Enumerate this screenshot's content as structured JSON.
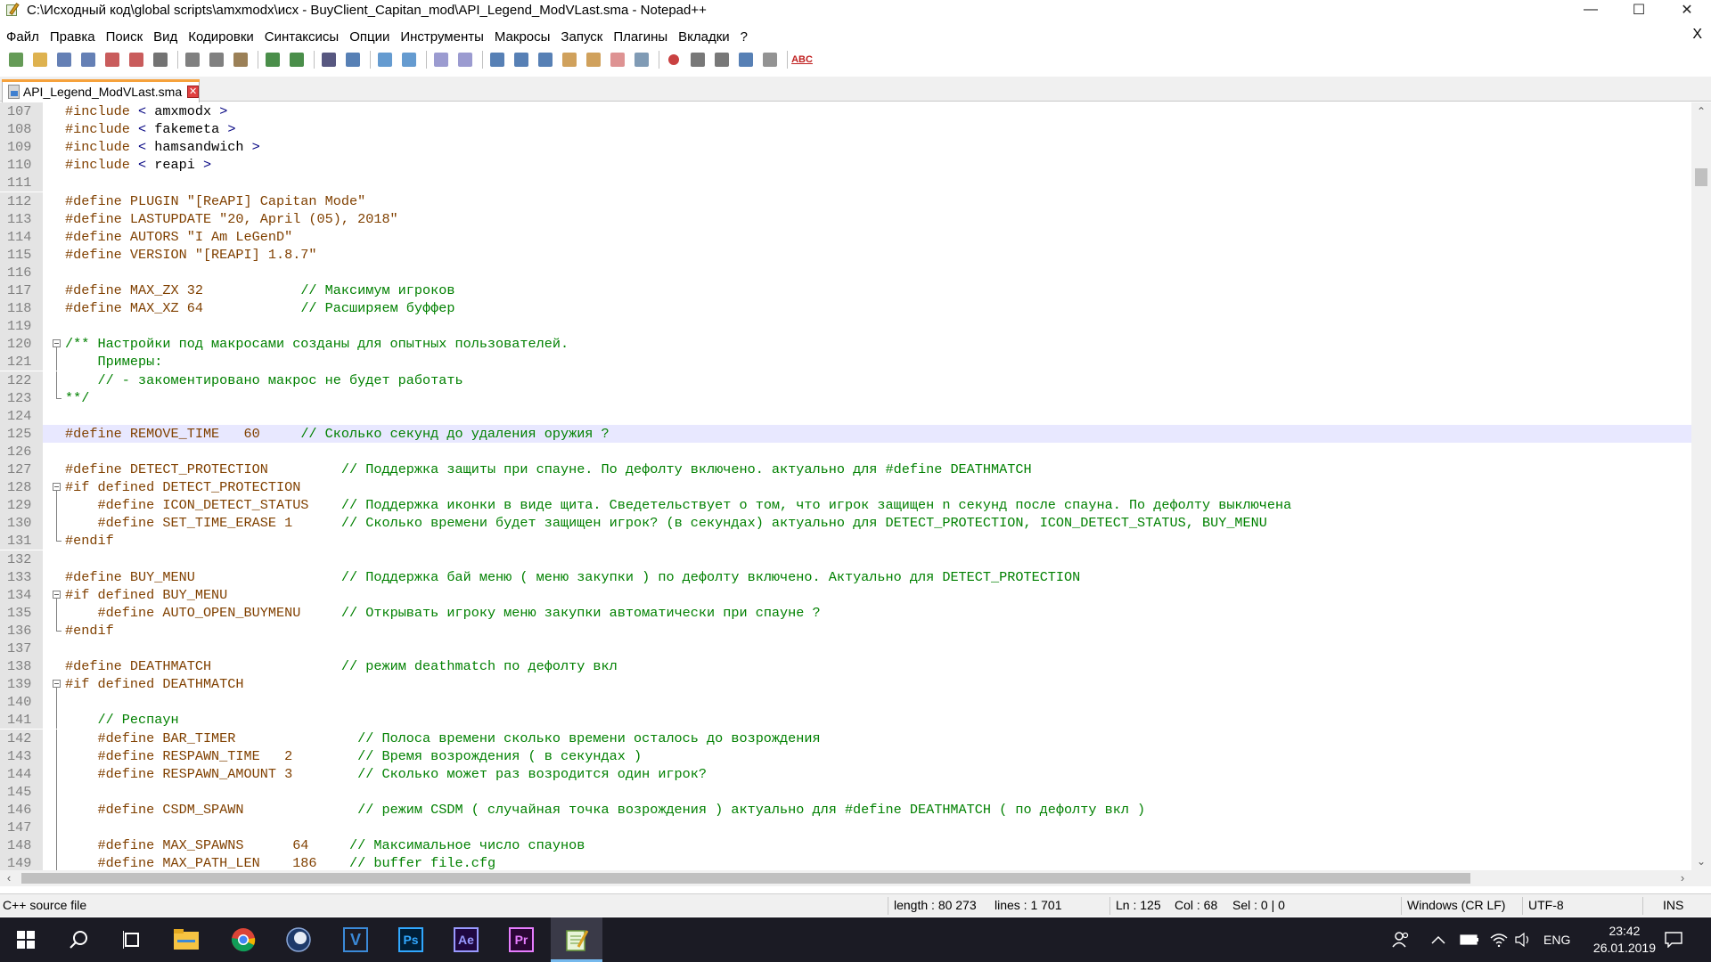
{
  "window": {
    "title": "C:\\Исходный код\\global scripts\\amxmodx\\исх - BuyClient_Capitan_mod\\API_Legend_ModVLast.sma - Notepad++",
    "minimize_glyph": "—",
    "maximize_glyph": "☐",
    "close_glyph": "✕"
  },
  "menu": {
    "items": [
      "Файл",
      "Правка",
      "Поиск",
      "Вид",
      "Кодировки",
      "Синтаксисы",
      "Опции",
      "Инструменты",
      "Макросы",
      "Запуск",
      "Плагины",
      "Вкладки",
      "?"
    ],
    "close_glyph": "X"
  },
  "toolbar": {
    "icons": [
      "new-file-icon",
      "open-file-icon",
      "save-icon",
      "save-all-icon",
      "close-file-icon",
      "close-all-icon",
      "print-icon",
      "cut-icon",
      "copy-icon",
      "paste-icon",
      "undo-icon",
      "redo-icon",
      "find-icon",
      "replace-icon",
      "zoom-in-icon",
      "zoom-out-icon",
      "sync-vertical-icon",
      "sync-horizontal-icon",
      "word-wrap-icon",
      "show-all-chars-icon",
      "indent-guide-icon",
      "doc-map-icon",
      "function-list-icon",
      "folder-workspace-icon",
      "monitoring-icon",
      "record-macro-icon",
      "stop-macro-icon",
      "play-macro-icon",
      "run-macro-multiple-icon",
      "save-macro-icon",
      "spellcheck-icon"
    ],
    "spellcheck_label": "ABC"
  },
  "tab": {
    "label": "API_Legend_ModVLast.sma",
    "close_glyph": "✕"
  },
  "editor": {
    "current_line": 125,
    "lines": [
      {
        "n": "107",
        "fold": "",
        "segs": [
          {
            "c": "pp",
            "t": "#include"
          },
          {
            "c": "tx",
            "t": " "
          },
          {
            "c": "op",
            "t": "<"
          },
          {
            "c": "tx",
            "t": " amxmodx "
          },
          {
            "c": "op",
            "t": ">"
          }
        ]
      },
      {
        "n": "108",
        "fold": "",
        "segs": [
          {
            "c": "pp",
            "t": "#include"
          },
          {
            "c": "tx",
            "t": " "
          },
          {
            "c": "op",
            "t": "<"
          },
          {
            "c": "tx",
            "t": " fakemeta "
          },
          {
            "c": "op",
            "t": ">"
          }
        ]
      },
      {
        "n": "109",
        "fold": "",
        "segs": [
          {
            "c": "pp",
            "t": "#include"
          },
          {
            "c": "tx",
            "t": " "
          },
          {
            "c": "op",
            "t": "<"
          },
          {
            "c": "tx",
            "t": " hamsandwich "
          },
          {
            "c": "op",
            "t": ">"
          }
        ]
      },
      {
        "n": "110",
        "fold": "",
        "segs": [
          {
            "c": "pp",
            "t": "#include"
          },
          {
            "c": "tx",
            "t": " "
          },
          {
            "c": "op",
            "t": "<"
          },
          {
            "c": "tx",
            "t": " reapi "
          },
          {
            "c": "op",
            "t": ">"
          }
        ]
      },
      {
        "n": "111",
        "fold": "",
        "segs": []
      },
      {
        "n": "112",
        "fold": "",
        "segs": [
          {
            "c": "pp",
            "t": "#define PLUGIN \"[ReAPI] Capitan Mode\""
          }
        ]
      },
      {
        "n": "113",
        "fold": "",
        "segs": [
          {
            "c": "pp",
            "t": "#define LASTUPDATE \"20, April (05), 2018\""
          }
        ]
      },
      {
        "n": "114",
        "fold": "",
        "segs": [
          {
            "c": "pp",
            "t": "#define AUTORS \"I Am LeGenD\""
          }
        ]
      },
      {
        "n": "115",
        "fold": "",
        "segs": [
          {
            "c": "pp",
            "t": "#define VERSION \"[REAPI] 1.8.7\""
          }
        ]
      },
      {
        "n": "116",
        "fold": "",
        "segs": []
      },
      {
        "n": "117",
        "fold": "",
        "segs": [
          {
            "c": "pp",
            "t": "#define MAX_ZX 32            "
          },
          {
            "c": "cm",
            "t": "// Максимум игроков"
          }
        ]
      },
      {
        "n": "118",
        "fold": "",
        "segs": [
          {
            "c": "pp",
            "t": "#define MAX_XZ 64            "
          },
          {
            "c": "cm",
            "t": "// Расширяем буффер"
          }
        ]
      },
      {
        "n": "119",
        "fold": "",
        "segs": []
      },
      {
        "n": "120",
        "fold": "open",
        "segs": [
          {
            "c": "cm",
            "t": "/** Настройки под макросами созданы для опытных пользователей."
          }
        ]
      },
      {
        "n": "121",
        "fold": "mid",
        "segs": [
          {
            "c": "cm",
            "t": "    Примеры:"
          }
        ]
      },
      {
        "n": "122",
        "fold": "mid",
        "segs": [
          {
            "c": "cm",
            "t": "    // - закоментировано макрос не будет работать"
          }
        ]
      },
      {
        "n": "123",
        "fold": "end",
        "segs": [
          {
            "c": "cm",
            "t": "**/"
          }
        ]
      },
      {
        "n": "124",
        "fold": "",
        "segs": []
      },
      {
        "n": "125",
        "fold": "",
        "segs": [
          {
            "c": "pp",
            "t": "#define REMOVE_TIME   60     "
          },
          {
            "c": "cm",
            "t": "// Сколько секунд до удаления оружия ?"
          }
        ]
      },
      {
        "n": "126",
        "fold": "",
        "segs": []
      },
      {
        "n": "127",
        "fold": "",
        "segs": [
          {
            "c": "pp",
            "t": "#define DETECT_PROTECTION         "
          },
          {
            "c": "cm",
            "t": "// Поддержка защиты при спауне. По дефолту включено. актуально для #define DEATHMATCH"
          }
        ]
      },
      {
        "n": "128",
        "fold": "open",
        "segs": [
          {
            "c": "pp",
            "t": "#if defined DETECT_PROTECTION"
          }
        ]
      },
      {
        "n": "129",
        "fold": "mid",
        "segs": [
          {
            "c": "pp",
            "t": "    #define ICON_DETECT_STATUS    "
          },
          {
            "c": "cm",
            "t": "// Поддержка иконки в виде щита. Сведетельствует о том, что игрок защищен n секунд после спауна. По дефолту выключена"
          }
        ]
      },
      {
        "n": "130",
        "fold": "mid",
        "segs": [
          {
            "c": "pp",
            "t": "    #define SET_TIME_ERASE 1      "
          },
          {
            "c": "cm",
            "t": "// Сколько времени будет защищен игрок? (в секундах) актуально для DETECT_PROTECTION, ICON_DETECT_STATUS, BUY_MENU"
          }
        ]
      },
      {
        "n": "131",
        "fold": "end",
        "segs": [
          {
            "c": "pp",
            "t": "#endif"
          }
        ]
      },
      {
        "n": "132",
        "fold": "",
        "segs": []
      },
      {
        "n": "133",
        "fold": "",
        "segs": [
          {
            "c": "pp",
            "t": "#define BUY_MENU                  "
          },
          {
            "c": "cm",
            "t": "// Поддержка бай меню ( меню закупки ) по дефолту включено. Актуально для DETECT_PROTECTION"
          }
        ]
      },
      {
        "n": "134",
        "fold": "open",
        "segs": [
          {
            "c": "pp",
            "t": "#if defined BUY_MENU"
          }
        ]
      },
      {
        "n": "135",
        "fold": "mid",
        "segs": [
          {
            "c": "pp",
            "t": "    #define AUTO_OPEN_BUYMENU     "
          },
          {
            "c": "cm",
            "t": "// Открывать игроку меню закупки автоматически при спауне ?"
          }
        ]
      },
      {
        "n": "136",
        "fold": "end",
        "segs": [
          {
            "c": "pp",
            "t": "#endif"
          }
        ]
      },
      {
        "n": "137",
        "fold": "",
        "segs": []
      },
      {
        "n": "138",
        "fold": "",
        "segs": [
          {
            "c": "pp",
            "t": "#define DEATHMATCH                "
          },
          {
            "c": "cm",
            "t": "// режим deathmatch по дефолту вкл"
          }
        ]
      },
      {
        "n": "139",
        "fold": "open",
        "segs": [
          {
            "c": "pp",
            "t": "#if defined DEATHMATCH"
          }
        ]
      },
      {
        "n": "140",
        "fold": "mid",
        "segs": []
      },
      {
        "n": "141",
        "fold": "mid",
        "segs": [
          {
            "c": "cm",
            "t": "    // Респаун"
          }
        ]
      },
      {
        "n": "142",
        "fold": "mid",
        "segs": [
          {
            "c": "pp",
            "t": "    #define BAR_TIMER               "
          },
          {
            "c": "cm",
            "t": "// Полоса времени сколько времени осталось до возрождения"
          }
        ]
      },
      {
        "n": "143",
        "fold": "mid",
        "segs": [
          {
            "c": "pp",
            "t": "    #define RESPAWN_TIME   2        "
          },
          {
            "c": "cm",
            "t": "// Время возрождения ( в секундах )"
          }
        ]
      },
      {
        "n": "144",
        "fold": "mid",
        "segs": [
          {
            "c": "pp",
            "t": "    #define RESPAWN_AMOUNT 3        "
          },
          {
            "c": "cm",
            "t": "// Сколько может раз возродится один игрок?"
          }
        ]
      },
      {
        "n": "145",
        "fold": "mid",
        "segs": []
      },
      {
        "n": "146",
        "fold": "mid",
        "segs": [
          {
            "c": "pp",
            "t": "    #define CSDM_SPAWN              "
          },
          {
            "c": "cm",
            "t": "// режим CSDM ( случайная точка возрождения ) актуально для #define DEATHMATCH ( по дефолту вкл )"
          }
        ]
      },
      {
        "n": "147",
        "fold": "mid",
        "segs": []
      },
      {
        "n": "148",
        "fold": "mid",
        "segs": [
          {
            "c": "pp",
            "t": "    #define MAX_SPAWNS      64     "
          },
          {
            "c": "cm",
            "t": "// Максимальное число спаунов"
          }
        ]
      },
      {
        "n": "149",
        "fold": "mid",
        "segs": [
          {
            "c": "pp",
            "t": "    #define MAX_PATH_LEN    186    "
          },
          {
            "c": "cm",
            "t": "// buffer file.cfg"
          }
        ]
      }
    ]
  },
  "scrollbars": {
    "up_glyph": "⌃",
    "down_glyph": "⌄",
    "left_glyph": "‹",
    "right_glyph": "›"
  },
  "statusbar": {
    "file_type": "C++ source file",
    "length": "length : 80 273",
    "lines": "lines : 1 701",
    "ln": "Ln : 125",
    "col": "Col : 68",
    "sel": "Sel : 0 | 0",
    "eol": "Windows (CR LF)",
    "encoding": "UTF-8",
    "mode": "INS"
  },
  "taskbar": {
    "apps": [
      "start-icon",
      "search-icon",
      "task-view-icon",
      "file-explorer-icon",
      "chrome-icon",
      "cinema4d-icon",
      "visual-studio-icon",
      "photoshop-icon",
      "after-effects-icon",
      "premiere-icon",
      "notepadpp-icon"
    ],
    "labels": {
      "vs": "V",
      "ps": "Ps",
      "ae": "Ae",
      "pr": "Pr"
    },
    "lang": "ENG",
    "time": "23:42",
    "date": "26.01.2019"
  },
  "colors": {
    "preprocessor": "#804000",
    "comment": "#008000",
    "operator": "#000080",
    "current_line_bg": "#e8e8ff",
    "tab_accent": "#f6a23c",
    "taskbar_bg": "#1b1b24"
  }
}
